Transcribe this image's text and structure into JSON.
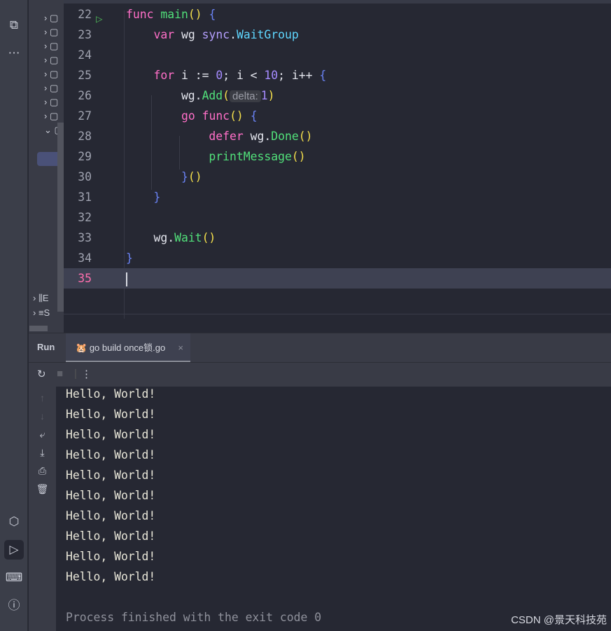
{
  "editor": {
    "lines": [
      {
        "n": "22"
      },
      {
        "n": "23"
      },
      {
        "n": "24"
      },
      {
        "n": "25"
      },
      {
        "n": "26"
      },
      {
        "n": "27"
      },
      {
        "n": "28"
      },
      {
        "n": "29"
      },
      {
        "n": "30"
      },
      {
        "n": "31"
      },
      {
        "n": "32"
      },
      {
        "n": "33"
      },
      {
        "n": "34"
      },
      {
        "n": "35"
      }
    ],
    "tokens": {
      "func": "func",
      "main": "main",
      "var": "var",
      "wg": "wg",
      "sync": "sync",
      "WaitGroup": "WaitGroup",
      "for": "for",
      "i": "i",
      "zero": "0",
      "ten": "10",
      "Add": "Add",
      "delta_hint": "delta:",
      "one": "1",
      "go": "go",
      "defer": "defer",
      "Done": "Done",
      "printMessage": "printMessage",
      "Wait": "Wait"
    }
  },
  "tree": {
    "items": [
      "E",
      "S"
    ]
  },
  "run": {
    "title": "Run",
    "tab_label": "go build once锁.go"
  },
  "console": {
    "lines": [
      "Hello, World!",
      "Hello, World!",
      "Hello, World!",
      "Hello, World!",
      "Hello, World!",
      "Hello, World!",
      "Hello, World!",
      "Hello, World!",
      "Hello, World!",
      "Hello, World!"
    ],
    "finish": "Process finished with the exit code 0"
  },
  "watermark": "CSDN @景天科技苑"
}
